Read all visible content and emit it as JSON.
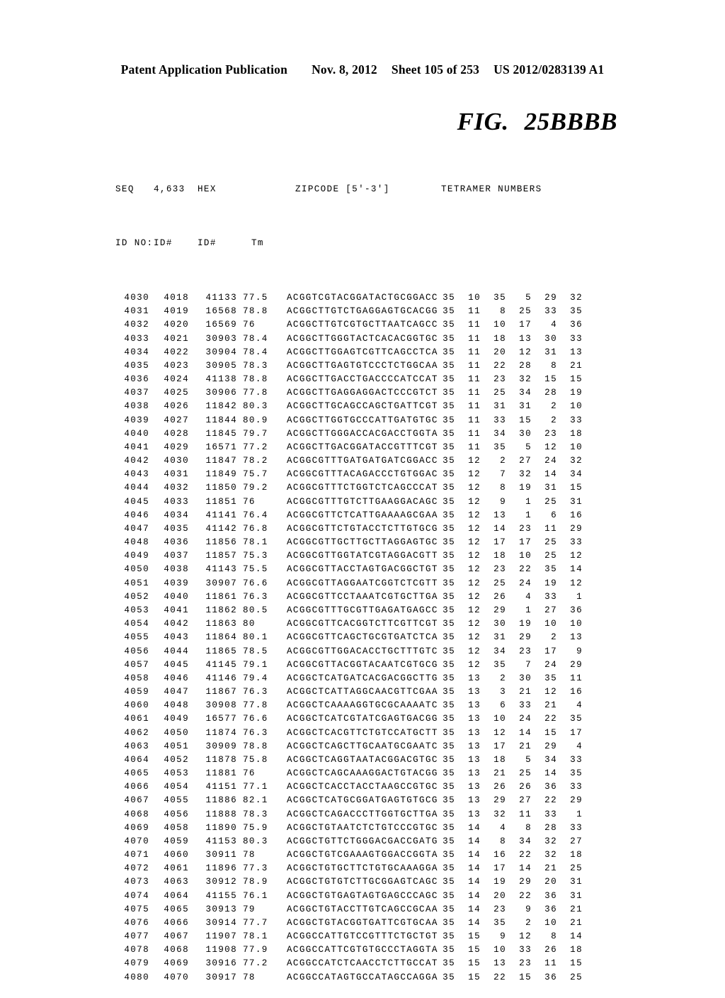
{
  "header": {
    "publication": "Patent Application Publication",
    "date": "Nov. 8, 2012",
    "sheet": "Sheet 105 of 253",
    "patent_number": "US 2012/0283139 A1"
  },
  "figure": {
    "label": "FIG.",
    "number": "25BBBB"
  },
  "table": {
    "headers_line1": {
      "seq": "SEQ",
      "id4633": "4,633",
      "hex": "HEX",
      "tm": "",
      "zipcode": "ZIPCODE [5'-3']",
      "tetramer": "TETRAMER NUMBERS"
    },
    "headers_line2": {
      "seq": "ID NO:",
      "id4633": "ID#",
      "hex": "ID#",
      "tm": "Tm"
    },
    "rows": [
      {
        "seq": "4030",
        "id": "4018",
        "hex": "41133",
        "tm": "77.5",
        "zip": "ACGGTCGTACGGATACTGCGGACC",
        "tet": [
          "35",
          "10",
          "35",
          "5",
          "29",
          "32"
        ]
      },
      {
        "seq": "4031",
        "id": "4019",
        "hex": "16568",
        "tm": "78.8",
        "zip": "ACGGCTTGTCTGAGGAGTGCACGG",
        "tet": [
          "35",
          "11",
          "8",
          "25",
          "33",
          "35"
        ]
      },
      {
        "seq": "4032",
        "id": "4020",
        "hex": "16569",
        "tm": "76",
        "zip": "ACGGCTTGTCGTGCTTAATCAGCC",
        "tet": [
          "35",
          "11",
          "10",
          "17",
          "4",
          "36"
        ]
      },
      {
        "seq": "4033",
        "id": "4021",
        "hex": "30903",
        "tm": "78.4",
        "zip": "ACGGCTTGGGTACTCACACGGTGC",
        "tet": [
          "35",
          "11",
          "18",
          "13",
          "30",
          "33"
        ]
      },
      {
        "seq": "4034",
        "id": "4022",
        "hex": "30904",
        "tm": "78.4",
        "zip": "ACGGCTTGGAGTCGTTCAGCCTCA",
        "tet": [
          "35",
          "11",
          "20",
          "12",
          "31",
          "13"
        ]
      },
      {
        "seq": "4035",
        "id": "4023",
        "hex": "30905",
        "tm": "78.3",
        "zip": "ACGGCTTGAGTGTCCCTCTGGCAA",
        "tet": [
          "35",
          "11",
          "22",
          "28",
          "8",
          "21"
        ]
      },
      {
        "seq": "4036",
        "id": "4024",
        "hex": "41138",
        "tm": "78.8",
        "zip": "ACGGCTTGACCTGACCCCATCCAT",
        "tet": [
          "35",
          "11",
          "23",
          "32",
          "15",
          "15"
        ]
      },
      {
        "seq": "4037",
        "id": "4025",
        "hex": "30906",
        "tm": "77.8",
        "zip": "ACGGCTTGAGGAGGACTCCCGTCT",
        "tet": [
          "35",
          "11",
          "25",
          "34",
          "28",
          "19"
        ]
      },
      {
        "seq": "4038",
        "id": "4026",
        "hex": "11842",
        "tm": "80.3",
        "zip": "ACGGCTTGCAGCCAGCTGATTCGT",
        "tet": [
          "35",
          "11",
          "31",
          "31",
          "2",
          "10"
        ]
      },
      {
        "seq": "4039",
        "id": "4027",
        "hex": "11844",
        "tm": "80.9",
        "zip": "ACGGCTTGGTGCCCATTGATGTGC",
        "tet": [
          "35",
          "11",
          "33",
          "15",
          "2",
          "33"
        ]
      },
      {
        "seq": "4040",
        "id": "4028",
        "hex": "11845",
        "tm": "79.7",
        "zip": "ACGGCTTGGGACCACGACCTGGTA",
        "tet": [
          "35",
          "11",
          "34",
          "30",
          "23",
          "18"
        ]
      },
      {
        "seq": "4041",
        "id": "4029",
        "hex": "16571",
        "tm": "77.2",
        "zip": "ACGGCTTGACGGATACCGTTTCGT",
        "tet": [
          "35",
          "11",
          "35",
          "5",
          "12",
          "10"
        ]
      },
      {
        "seq": "4042",
        "id": "4030",
        "hex": "11847",
        "tm": "78.2",
        "zip": "ACGGCGTTTGATGATGATCGGACC",
        "tet": [
          "35",
          "12",
          "2",
          "27",
          "24",
          "32"
        ]
      },
      {
        "seq": "4043",
        "id": "4031",
        "hex": "11849",
        "tm": "75.7",
        "zip": "ACGGCGTTTACAGACCCTGTGGAC",
        "tet": [
          "35",
          "12",
          "7",
          "32",
          "14",
          "34"
        ]
      },
      {
        "seq": "4044",
        "id": "4032",
        "hex": "11850",
        "tm": "79.2",
        "zip": "ACGGCGTTTCTGGTCTCAGCCCAT",
        "tet": [
          "35",
          "12",
          "8",
          "19",
          "31",
          "15"
        ]
      },
      {
        "seq": "4045",
        "id": "4033",
        "hex": "11851",
        "tm": "76",
        "zip": "ACGGCGTTTGTCTTGAAGGACAGC",
        "tet": [
          "35",
          "12",
          "9",
          "1",
          "25",
          "31"
        ]
      },
      {
        "seq": "4046",
        "id": "4034",
        "hex": "41141",
        "tm": "76.4",
        "zip": "ACGGCGTTCTCATTGAAAAGCGAA",
        "tet": [
          "35",
          "12",
          "13",
          "1",
          "6",
          "16"
        ]
      },
      {
        "seq": "4047",
        "id": "4035",
        "hex": "41142",
        "tm": "76.8",
        "zip": "ACGGCGTTCTGTACCTCTTGTGCG",
        "tet": [
          "35",
          "12",
          "14",
          "23",
          "11",
          "29"
        ]
      },
      {
        "seq": "4048",
        "id": "4036",
        "hex": "11856",
        "tm": "78.1",
        "zip": "ACGGCGTTGCTTGCTTAGGAGTGC",
        "tet": [
          "35",
          "12",
          "17",
          "17",
          "25",
          "33"
        ]
      },
      {
        "seq": "4049",
        "id": "4037",
        "hex": "11857",
        "tm": "75.3",
        "zip": "ACGGCGTTGGTATCGTAGGACGTT",
        "tet": [
          "35",
          "12",
          "18",
          "10",
          "25",
          "12"
        ]
      },
      {
        "seq": "4050",
        "id": "4038",
        "hex": "41143",
        "tm": "75.5",
        "zip": "ACGGCGTTACCTAGTGACGGCTGT",
        "tet": [
          "35",
          "12",
          "23",
          "22",
          "35",
          "14"
        ]
      },
      {
        "seq": "4051",
        "id": "4039",
        "hex": "30907",
        "tm": "76.6",
        "zip": "ACGGCGTTAGGAATCGGTCTCGTT",
        "tet": [
          "35",
          "12",
          "25",
          "24",
          "19",
          "12"
        ]
      },
      {
        "seq": "4052",
        "id": "4040",
        "hex": "11861",
        "tm": "76.3",
        "zip": "ACGGCGTTCCTAAATCGTGCTTGA",
        "tet": [
          "35",
          "12",
          "26",
          "4",
          "33",
          "1"
        ]
      },
      {
        "seq": "4053",
        "id": "4041",
        "hex": "11862",
        "tm": "80.5",
        "zip": "ACGGCGTTTGCGTTGAGATGAGCC",
        "tet": [
          "35",
          "12",
          "29",
          "1",
          "27",
          "36"
        ]
      },
      {
        "seq": "4054",
        "id": "4042",
        "hex": "11863",
        "tm": "80",
        "zip": "ACGGCGTTCACGGTCTTCGTTCGT",
        "tet": [
          "35",
          "12",
          "30",
          "19",
          "10",
          "10"
        ]
      },
      {
        "seq": "4055",
        "id": "4043",
        "hex": "11864",
        "tm": "80.1",
        "zip": "ACGGCGTTCAGCTGCGTGATCTCA",
        "tet": [
          "35",
          "12",
          "31",
          "29",
          "2",
          "13"
        ]
      },
      {
        "seq": "4056",
        "id": "4044",
        "hex": "11865",
        "tm": "78.5",
        "zip": "ACGGCGTTGGACACCTGCTTTGTC",
        "tet": [
          "35",
          "12",
          "34",
          "23",
          "17",
          "9"
        ]
      },
      {
        "seq": "4057",
        "id": "4045",
        "hex": "41145",
        "tm": "79.1",
        "zip": "ACGGCGTTACGGTACAATCGTGCG",
        "tet": [
          "35",
          "12",
          "35",
          "7",
          "24",
          "29"
        ]
      },
      {
        "seq": "4058",
        "id": "4046",
        "hex": "41146",
        "tm": "79.4",
        "zip": "ACGGCTCATGATCACGACGGCTTG",
        "tet": [
          "35",
          "13",
          "2",
          "30",
          "35",
          "11"
        ]
      },
      {
        "seq": "4059",
        "id": "4047",
        "hex": "11867",
        "tm": "76.3",
        "zip": "ACGGCTCATTAGGCAACGTTCGAA",
        "tet": [
          "35",
          "13",
          "3",
          "21",
          "12",
          "16"
        ]
      },
      {
        "seq": "4060",
        "id": "4048",
        "hex": "30908",
        "tm": "77.8",
        "zip": "ACGGCTCAAAAGGTGCGCAAAATC",
        "tet": [
          "35",
          "13",
          "6",
          "33",
          "21",
          "4"
        ]
      },
      {
        "seq": "4061",
        "id": "4049",
        "hex": "16577",
        "tm": "76.6",
        "zip": "ACGGCTCATCGTATCGAGTGACGG",
        "tet": [
          "35",
          "13",
          "10",
          "24",
          "22",
          "35"
        ]
      },
      {
        "seq": "4062",
        "id": "4050",
        "hex": "11874",
        "tm": "76.3",
        "zip": "ACGGCTCACGTTCTGTCCATGCTT",
        "tet": [
          "35",
          "13",
          "12",
          "14",
          "15",
          "17"
        ]
      },
      {
        "seq": "4063",
        "id": "4051",
        "hex": "30909",
        "tm": "78.8",
        "zip": "ACGGCTCAGCTTGCAATGCGAATC",
        "tet": [
          "35",
          "13",
          "17",
          "21",
          "29",
          "4"
        ]
      },
      {
        "seq": "4064",
        "id": "4052",
        "hex": "11878",
        "tm": "75.8",
        "zip": "ACGGCTCAGGTAATACGGACGTGC",
        "tet": [
          "35",
          "13",
          "18",
          "5",
          "34",
          "33"
        ]
      },
      {
        "seq": "4065",
        "id": "4053",
        "hex": "11881",
        "tm": "76",
        "zip": "ACGGCTCAGCAAAGGACTGTACGG",
        "tet": [
          "35",
          "13",
          "21",
          "25",
          "14",
          "35"
        ]
      },
      {
        "seq": "4066",
        "id": "4054",
        "hex": "41151",
        "tm": "77.1",
        "zip": "ACGGCTCACCTACCTAAGCCGTGC",
        "tet": [
          "35",
          "13",
          "26",
          "26",
          "36",
          "33"
        ]
      },
      {
        "seq": "4067",
        "id": "4055",
        "hex": "11886",
        "tm": "82.1",
        "zip": "ACGGCTCATGCGGATGAGTGTGCG",
        "tet": [
          "35",
          "13",
          "29",
          "27",
          "22",
          "29"
        ]
      },
      {
        "seq": "4068",
        "id": "4056",
        "hex": "11888",
        "tm": "78.3",
        "zip": "ACGGCTCAGACCCTTGGTGCTTGA",
        "tet": [
          "35",
          "13",
          "32",
          "11",
          "33",
          "1"
        ]
      },
      {
        "seq": "4069",
        "id": "4058",
        "hex": "11890",
        "tm": "75.9",
        "zip": "ACGGCTGTAATCTCTGTCCCGTGC",
        "tet": [
          "35",
          "14",
          "4",
          "8",
          "28",
          "33"
        ]
      },
      {
        "seq": "4070",
        "id": "4059",
        "hex": "41153",
        "tm": "80.3",
        "zip": "ACGGCTGTTCTGGGACGACCGATG",
        "tet": [
          "35",
          "14",
          "8",
          "34",
          "32",
          "27"
        ]
      },
      {
        "seq": "4071",
        "id": "4060",
        "hex": "30911",
        "tm": "78",
        "zip": "ACGGCTGTCGAAAGTGGACCGGTA",
        "tet": [
          "35",
          "14",
          "16",
          "22",
          "32",
          "18"
        ]
      },
      {
        "seq": "4072",
        "id": "4061",
        "hex": "11896",
        "tm": "77.3",
        "zip": "ACGGCTGTGCTTCTGTGCAAAGGA",
        "tet": [
          "35",
          "14",
          "17",
          "14",
          "21",
          "25"
        ]
      },
      {
        "seq": "4073",
        "id": "4063",
        "hex": "30912",
        "tm": "78.9",
        "zip": "ACGGCTGTGTCTTGCGGAGTCAGC",
        "tet": [
          "35",
          "14",
          "19",
          "29",
          "20",
          "31"
        ]
      },
      {
        "seq": "4074",
        "id": "4064",
        "hex": "41155",
        "tm": "76.1",
        "zip": "ACGGCTGTGAGTAGTGAGCCCAGC",
        "tet": [
          "35",
          "14",
          "20",
          "22",
          "36",
          "31"
        ]
      },
      {
        "seq": "4075",
        "id": "4065",
        "hex": "30913",
        "tm": "79",
        "zip": "ACGGCTGTACCTTGTCAGCCGCAA",
        "tet": [
          "35",
          "14",
          "23",
          "9",
          "36",
          "21"
        ]
      },
      {
        "seq": "4076",
        "id": "4066",
        "hex": "30914",
        "tm": "77.7",
        "zip": "ACGGCTGTACGGTGATTCGTGCAA",
        "tet": [
          "35",
          "14",
          "35",
          "2",
          "10",
          "21"
        ]
      },
      {
        "seq": "4077",
        "id": "4067",
        "hex": "11907",
        "tm": "78.1",
        "zip": "ACGGCCATTGTCCGTTTCTGCTGT",
        "tet": [
          "35",
          "15",
          "9",
          "12",
          "8",
          "14"
        ]
      },
      {
        "seq": "4078",
        "id": "4068",
        "hex": "11908",
        "tm": "77.9",
        "zip": "ACGGCCATTCGTGTGCCCTAGGTA",
        "tet": [
          "35",
          "15",
          "10",
          "33",
          "26",
          "18"
        ]
      },
      {
        "seq": "4079",
        "id": "4069",
        "hex": "30916",
        "tm": "77.2",
        "zip": "ACGGCCATCTCAACCTCTTGCCAT",
        "tet": [
          "35",
          "15",
          "13",
          "23",
          "11",
          "15"
        ]
      },
      {
        "seq": "4080",
        "id": "4070",
        "hex": "30917",
        "tm": "78",
        "zip": "ACGGCCATAGTGCCATAGCCAGGA",
        "tet": [
          "35",
          "15",
          "22",
          "15",
          "36",
          "25"
        ]
      }
    ]
  }
}
